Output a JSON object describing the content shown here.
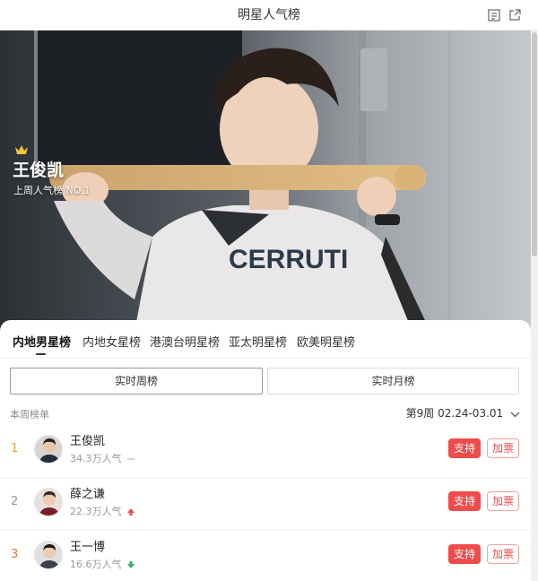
{
  "header": {
    "title": "明星人气榜",
    "icons": [
      "document-icon",
      "share-icon"
    ]
  },
  "hero": {
    "star_name": "王俊凯",
    "rank_text": "上周人气榜 NO.1",
    "shirt_text": "CERRUTI"
  },
  "tabs": [
    {
      "label": "内地男星榜",
      "active": true
    },
    {
      "label": "内地女星榜",
      "active": false
    },
    {
      "label": "港澳台明星榜",
      "active": false
    },
    {
      "label": "亚太明星榜",
      "active": false
    },
    {
      "label": "欧美明星榜",
      "active": false
    }
  ],
  "segments": [
    {
      "label": "实时周榜",
      "active": true
    },
    {
      "label": "实时月榜",
      "active": false
    }
  ],
  "list": {
    "section_label": "本周榜单",
    "week_selector": "第9周 02.24-03.01",
    "support_label": "支持",
    "vote_label": "加票",
    "rows": [
      {
        "rank": "1",
        "name": "王俊凯",
        "popularity": "34.3万人气",
        "trend": "flat",
        "rank_color": "#e8a33d"
      },
      {
        "rank": "2",
        "name": "薛之谦",
        "popularity": "22.3万人气",
        "trend": "up",
        "rank_color": "#999999"
      },
      {
        "rank": "3",
        "name": "王一博",
        "popularity": "16.6万人气",
        "trend": "down",
        "rank_color": "#e07b39"
      }
    ]
  },
  "colors": {
    "accent_red": "#f04b4b",
    "up_red": "#f04b4b",
    "down_green": "#2db36b"
  }
}
